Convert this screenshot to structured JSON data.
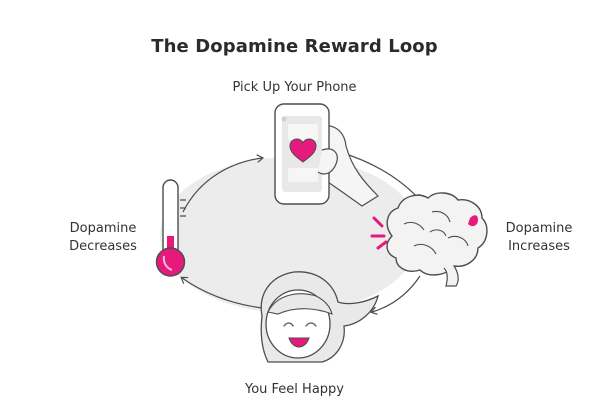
{
  "diagram": {
    "title": "The Dopamine Reward Loop",
    "steps": {
      "top": "Pick Up Your Phone",
      "right_line1": "Dopamine",
      "right_line2": "Increases",
      "bottom": "You Feel Happy",
      "left_line1": "Dopamine",
      "left_line2": "Decreases"
    }
  },
  "colors": {
    "accent": "#e6197d",
    "outline": "#4d4d4d",
    "fill_light": "#ececec"
  },
  "icons": [
    "phone-icon",
    "heart-icon",
    "brain-icon",
    "happy-face-icon",
    "thermometer-icon"
  ]
}
